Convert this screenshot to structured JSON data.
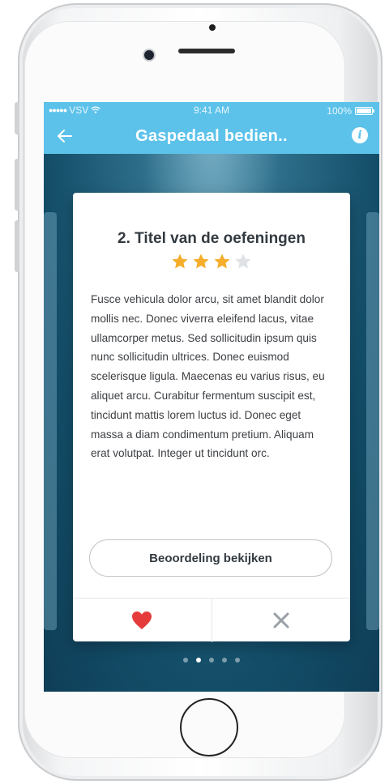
{
  "status_bar": {
    "carrier": "VSV",
    "time": "9:41 AM",
    "battery": "100%"
  },
  "nav": {
    "title": "Gaspedaal bedien..",
    "back_icon": "back-arrow-icon",
    "info_icon": "info-icon"
  },
  "card": {
    "title": "2. Titel van de oefeningen",
    "rating": 3,
    "rating_max": 4,
    "body": "Fusce vehicula dolor arcu, sit amet blandit dolor mollis nec. Donec viverra eleifend lacus, vitae ullamcorper metus. Sed sollicitudin ipsum quis nunc sollicitudin ultrices. Donec euismod scelerisque ligula. Maecenas eu varius risus, eu aliquet arcu. Curabitur fermentum suscipit est, tincidunt mattis lorem luctus id. Donec eget massa a diam condimentum pretium. Aliquam erat volutpat. Integer ut tincidunt orc.",
    "button_label": "Beoordeling bekijken",
    "like_icon": "heart-icon",
    "dismiss_icon": "close-icon"
  },
  "pager": {
    "count": 5,
    "active_index": 1
  },
  "colors": {
    "nav_background": "#5cc2ea",
    "star_filled": "#f5ad2b",
    "star_empty": "#dfe2e5",
    "heart": "#e53b3b",
    "close": "#9aa0a6"
  }
}
